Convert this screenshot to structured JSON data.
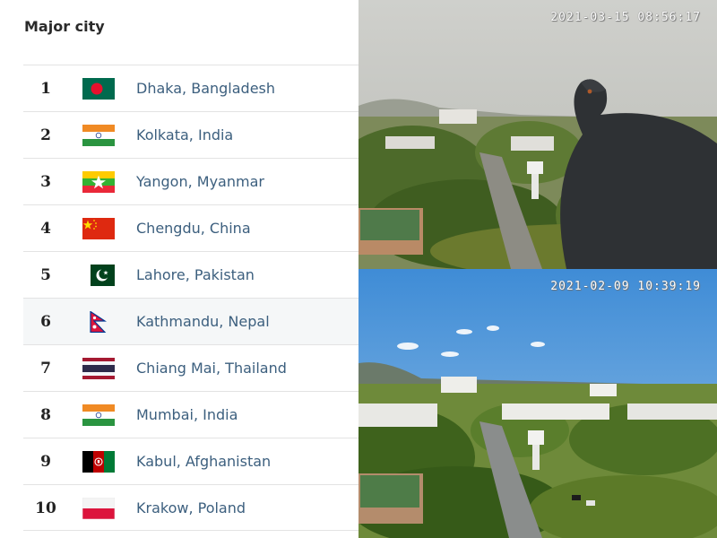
{
  "ranking": {
    "heading": "Major city",
    "rows": [
      {
        "rank": "1",
        "city": "Dhaka, Bangladesh",
        "flag": "bangladesh-flag"
      },
      {
        "rank": "2",
        "city": "Kolkata, India",
        "flag": "india-flag"
      },
      {
        "rank": "3",
        "city": "Yangon, Myanmar",
        "flag": "myanmar-flag"
      },
      {
        "rank": "4",
        "city": "Chengdu, China",
        "flag": "china-flag"
      },
      {
        "rank": "5",
        "city": "Lahore, Pakistan",
        "flag": "pakistan-flag"
      },
      {
        "rank": "6",
        "city": "Kathmandu, Nepal",
        "flag": "nepal-flag"
      },
      {
        "rank": "7",
        "city": "Chiang Mai, Thailand",
        "flag": "thailand-flag"
      },
      {
        "rank": "8",
        "city": "Mumbai, India",
        "flag": "india-flag"
      },
      {
        "rank": "9",
        "city": "Kabul, Afghanistan",
        "flag": "afghanistan-flag"
      },
      {
        "rank": "10",
        "city": "Krakow, Poland",
        "flag": "poland-flag"
      }
    ]
  },
  "photos": {
    "top": {
      "timestamp": "2021-03-15 08:56:17"
    },
    "bottom": {
      "timestamp": "2021-02-09 10:39:19"
    }
  }
}
